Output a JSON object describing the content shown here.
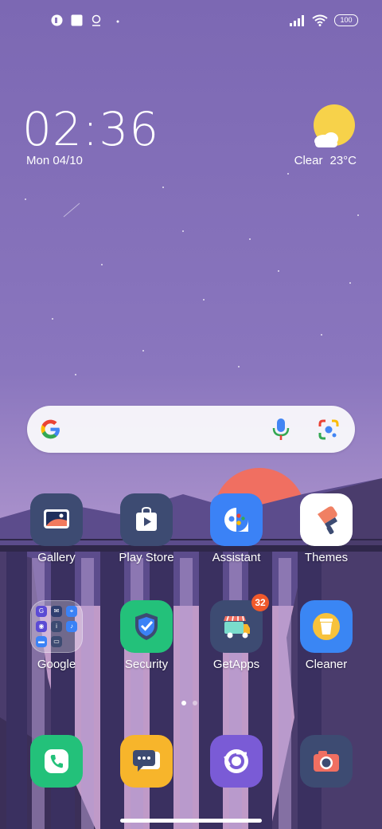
{
  "status_bar": {
    "left_icons": [
      "app-notification-icon",
      "square-notification-icon",
      "location-notification-icon",
      "dot-indicator"
    ],
    "right_icons": [
      "signal-icon",
      "wifi-icon"
    ],
    "battery": "100"
  },
  "clock": {
    "time": "02:36",
    "date": "Mon 04/10"
  },
  "weather": {
    "condition": "Clear",
    "temperature": "23°C",
    "icon": "sun-cloud-icon"
  },
  "search": {
    "icons": [
      "google-g-icon",
      "microphone-icon",
      "lens-icon"
    ]
  },
  "apps": {
    "row1": [
      {
        "label": "Gallery",
        "icon": "gallery-icon",
        "color": "#3d4b72"
      },
      {
        "label": "Play Store",
        "icon": "play-store-icon",
        "color": "#3d4b72"
      },
      {
        "label": "Assistant",
        "icon": "assistant-icon",
        "color": "#3b82f6"
      },
      {
        "label": "Themes",
        "icon": "themes-brush-icon",
        "color": "#ffffff"
      }
    ],
    "row2": [
      {
        "label": "Google",
        "icon": "google-folder-icon"
      },
      {
        "label": "Security",
        "icon": "security-shield-icon",
        "color": "#23c17a"
      },
      {
        "label": "GetApps",
        "icon": "getapps-truck-icon",
        "color": "#3d4b72",
        "badge": "32"
      },
      {
        "label": "Cleaner",
        "icon": "cleaner-bin-icon",
        "color": "#3a86f4"
      }
    ],
    "dock": [
      {
        "icon": "phone-icon",
        "color": "#23c17a"
      },
      {
        "icon": "messages-icon",
        "color": "#f7b52b"
      },
      {
        "icon": "chrome-browser-icon",
        "color": "#7a5bd6"
      },
      {
        "icon": "camera-icon",
        "color": "#3d4b72"
      }
    ]
  },
  "folder_contents": [
    "G",
    "✉",
    "⌖",
    "◉",
    "i",
    "♪",
    "▬",
    "▭"
  ],
  "pages": {
    "count": 2,
    "current": 1
  }
}
